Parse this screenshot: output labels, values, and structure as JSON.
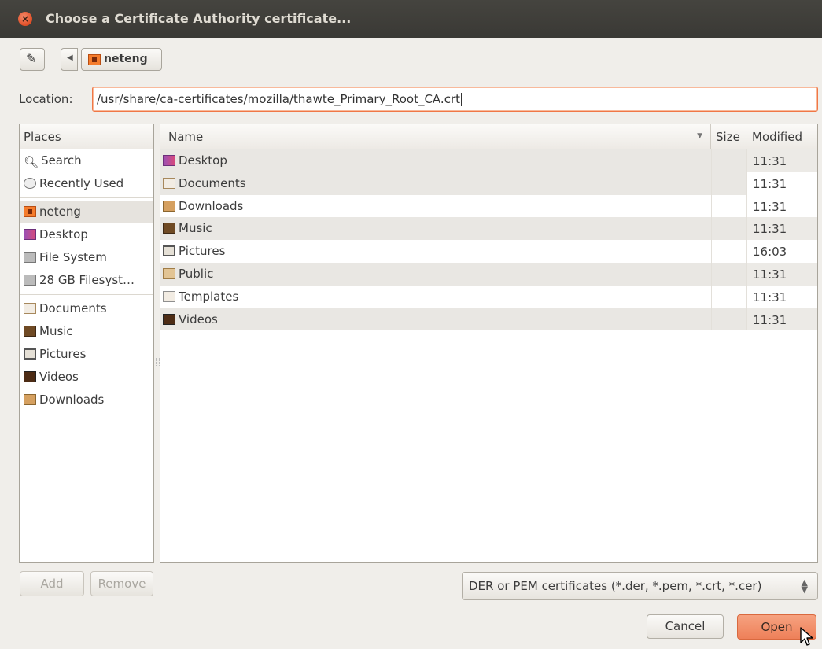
{
  "window": {
    "title": "Choose a Certificate Authority certificate..."
  },
  "toolbar": {
    "breadcrumb": "neteng"
  },
  "location": {
    "label": "Location:",
    "value": "/usr/share/ca-certificates/mozilla/thawte_Primary_Root_CA.crt"
  },
  "places": {
    "header": "Places",
    "items": [
      {
        "label": "Search",
        "icon": "search-icon"
      },
      {
        "label": "Recently Used",
        "icon": "clock-icon"
      },
      {
        "label": "neteng",
        "icon": "home-folder-icon",
        "selected": true
      },
      {
        "label": "Desktop",
        "icon": "desktop-icon"
      },
      {
        "label": "File System",
        "icon": "drive-icon"
      },
      {
        "label": "28 GB Filesyst…",
        "icon": "drive-icon"
      },
      {
        "label": "Documents",
        "icon": "documents-folder-icon"
      },
      {
        "label": "Music",
        "icon": "music-folder-icon"
      },
      {
        "label": "Pictures",
        "icon": "pictures-folder-icon"
      },
      {
        "label": "Videos",
        "icon": "videos-folder-icon"
      },
      {
        "label": "Downloads",
        "icon": "downloads-folder-icon"
      }
    ]
  },
  "files": {
    "columns": {
      "name": "Name",
      "size": "Size",
      "modified": "Modified"
    },
    "rows": [
      {
        "name": "Desktop",
        "size": "",
        "modified": "11:31",
        "icon": "desktop-icon"
      },
      {
        "name": "Documents",
        "size": "",
        "modified": "11:31",
        "icon": "documents-folder-icon"
      },
      {
        "name": "Downloads",
        "size": "",
        "modified": "11:31",
        "icon": "downloads-folder-icon"
      },
      {
        "name": "Music",
        "size": "",
        "modified": "11:31",
        "icon": "music-folder-icon"
      },
      {
        "name": "Pictures",
        "size": "",
        "modified": "16:03",
        "icon": "pictures-folder-icon"
      },
      {
        "name": "Public",
        "size": "",
        "modified": "11:31",
        "icon": "public-folder-icon"
      },
      {
        "name": "Templates",
        "size": "",
        "modified": "11:31",
        "icon": "templates-folder-icon"
      },
      {
        "name": "Videos",
        "size": "",
        "modified": "11:31",
        "icon": "videos-folder-icon"
      }
    ]
  },
  "buttons": {
    "add": "Add",
    "remove": "Remove",
    "cancel": "Cancel",
    "open": "Open"
  },
  "filter": {
    "selected": "DER or PEM certificates (*.der, *.pem, *.crt, *.cer)"
  },
  "colors": {
    "accent": "#ee8059",
    "titlebar": "#3c3b37",
    "close": "#e04e26"
  }
}
